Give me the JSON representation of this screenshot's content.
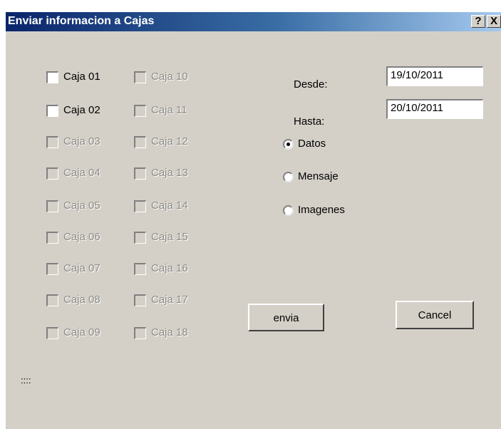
{
  "window": {
    "title": "Enviar informacion a Cajas",
    "help_label": "?",
    "close_label": "X"
  },
  "cajas": [
    {
      "label": "Caja 01",
      "checked": false,
      "enabled": true
    },
    {
      "label": "Caja 02",
      "checked": false,
      "enabled": true
    },
    {
      "label": "Caja 03",
      "checked": false,
      "enabled": false
    },
    {
      "label": "Caja 04",
      "checked": false,
      "enabled": false
    },
    {
      "label": "Caja 05",
      "checked": false,
      "enabled": false
    },
    {
      "label": "Caja 06",
      "checked": false,
      "enabled": false
    },
    {
      "label": "Caja 07",
      "checked": false,
      "enabled": false
    },
    {
      "label": "Caja 08",
      "checked": false,
      "enabled": false
    },
    {
      "label": "Caja 09",
      "checked": false,
      "enabled": false
    },
    {
      "label": "Caja 10",
      "checked": false,
      "enabled": false
    },
    {
      "label": "Caja 11",
      "checked": false,
      "enabled": false
    },
    {
      "label": "Caja 12",
      "checked": false,
      "enabled": false
    },
    {
      "label": "Caja 13",
      "checked": false,
      "enabled": false
    },
    {
      "label": "Caja 14",
      "checked": false,
      "enabled": false
    },
    {
      "label": "Caja 15",
      "checked": false,
      "enabled": false
    },
    {
      "label": "Caja 16",
      "checked": false,
      "enabled": false
    },
    {
      "label": "Caja 17",
      "checked": false,
      "enabled": false
    },
    {
      "label": "Caja 18",
      "checked": false,
      "enabled": false
    }
  ],
  "dates": {
    "desde_label": "Desde:",
    "desde_value": "19/10/2011",
    "hasta_label": "Hasta:",
    "hasta_value": "20/10/2011"
  },
  "options": [
    {
      "label": "Datos",
      "selected": true
    },
    {
      "label": "Mensaje",
      "selected": false
    },
    {
      "label": "Imagenes",
      "selected": false
    }
  ],
  "buttons": {
    "send_label": "envia",
    "cancel_label": "Cancel"
  },
  "status_text": "::::"
}
